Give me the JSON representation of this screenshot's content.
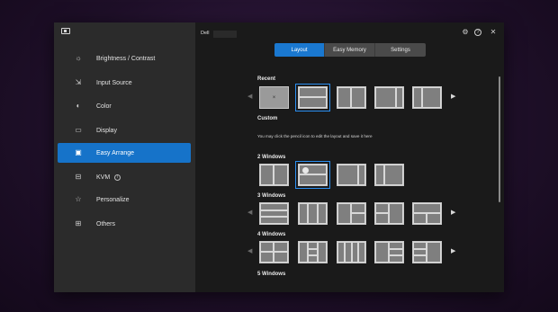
{
  "app": {
    "monitor_name": "Dell"
  },
  "sidebar": {
    "items": [
      {
        "label": "Brightness / Contrast",
        "icon": "sun-icon",
        "glyph": "☼",
        "active": false
      },
      {
        "label": "Input Source",
        "icon": "input-source-icon",
        "glyph": "⇲",
        "active": false
      },
      {
        "label": "Color",
        "icon": "palette-icon",
        "glyph": "◐",
        "active": false
      },
      {
        "label": "Display",
        "icon": "monitor-icon",
        "glyph": "▭",
        "active": false
      },
      {
        "label": "Easy Arrange",
        "icon": "easy-arrange-icon",
        "glyph": "▣",
        "active": true
      },
      {
        "label": "KVM",
        "icon": "kvm-icon",
        "glyph": "⊟",
        "active": false,
        "info": "i"
      },
      {
        "label": "Personalize",
        "icon": "star-icon",
        "glyph": "☆",
        "active": false
      },
      {
        "label": "Others",
        "icon": "others-icon",
        "glyph": "⊞",
        "active": false
      }
    ]
  },
  "window_controls": {
    "settings_glyph": "⚙",
    "help_glyph": "?",
    "close_glyph": "✕"
  },
  "tabs": [
    {
      "label": "Layout",
      "active": true
    },
    {
      "label": "Easy Memory",
      "active": false
    },
    {
      "label": "Settings",
      "active": false
    }
  ],
  "sections": {
    "recent": "Recent",
    "custom": "Custom",
    "custom_hint": "You may click the pencil icon to edit the layout and save it here",
    "two_windows": "2 Windows",
    "three_windows": "3 Windows",
    "four_windows": "4 Windows",
    "five_windows": "5 Windows"
  },
  "arrows": {
    "left": "◀",
    "right": "▶"
  },
  "recent_x": "×",
  "colors": {
    "accent": "#1a78d0",
    "sidebar_active": "#1673c9"
  }
}
